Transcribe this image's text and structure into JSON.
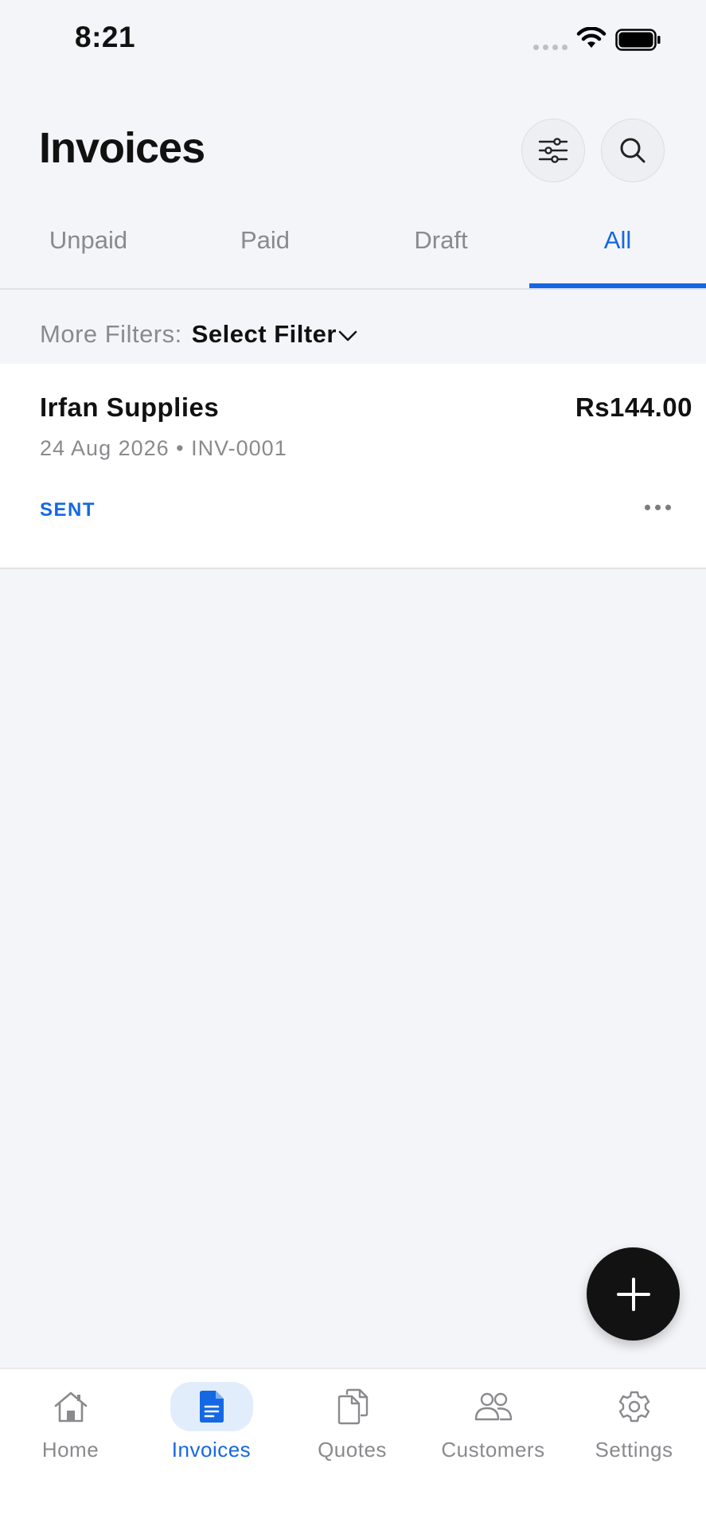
{
  "status_bar": {
    "time": "8:21"
  },
  "header": {
    "title": "Invoices"
  },
  "tabs": [
    {
      "label": "Unpaid",
      "active": false
    },
    {
      "label": "Paid",
      "active": false
    },
    {
      "label": "Draft",
      "active": false
    },
    {
      "label": "All",
      "active": true
    }
  ],
  "filters": {
    "label": "More Filters:",
    "selected": "Select Filter"
  },
  "invoices": [
    {
      "customer": "Irfan Supplies",
      "amount": "Rs144.00",
      "date": "24 Aug 2026",
      "separator": "•",
      "number": "INV-0001",
      "status": "SENT"
    }
  ],
  "bottom_nav": [
    {
      "label": "Home",
      "icon": "home-icon",
      "active": false
    },
    {
      "label": "Invoices",
      "icon": "invoice-document-icon",
      "active": true
    },
    {
      "label": "Quotes",
      "icon": "quotes-documents-icon",
      "active": false
    },
    {
      "label": "Customers",
      "icon": "customers-icon",
      "active": false
    },
    {
      "label": "Settings",
      "icon": "gear-icon",
      "active": false
    }
  ],
  "colors": {
    "accent": "#1468e3",
    "background": "#f4f5f9",
    "fab": "#121212"
  }
}
